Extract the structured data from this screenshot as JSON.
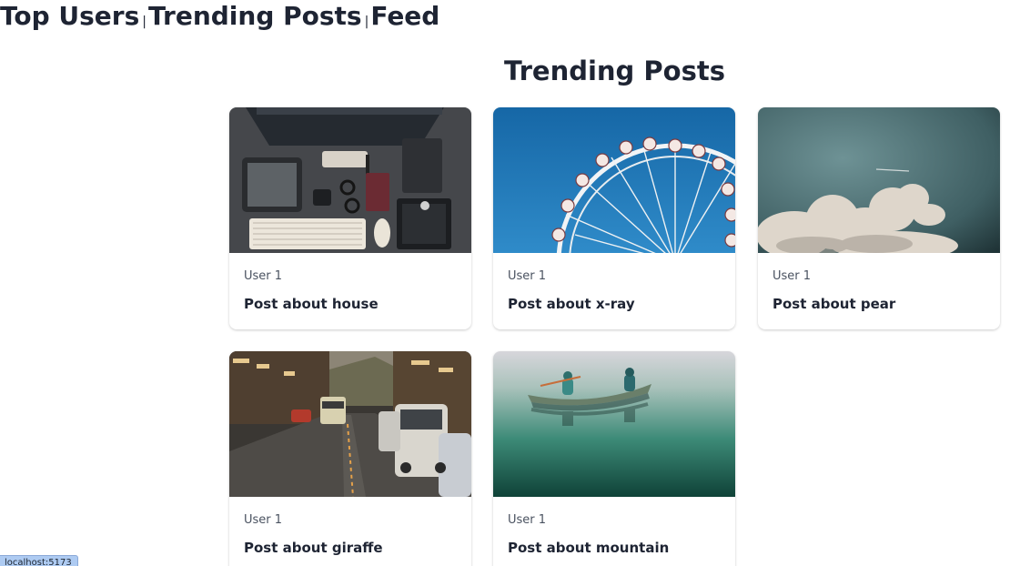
{
  "nav": {
    "links": [
      "Top Users",
      "Trending Posts",
      "Feed"
    ],
    "separator": "|"
  },
  "page": {
    "title": "Trending Posts"
  },
  "posts": [
    {
      "user": "User 1",
      "title": "Post about house",
      "image": "desk-workspace-photo"
    },
    {
      "user": "User 1",
      "title": "Post about x-ray",
      "image": "ferris-wheel-photo"
    },
    {
      "user": "User 1",
      "title": "Post about pear",
      "image": "clouds-sky-photo"
    },
    {
      "user": "User 1",
      "title": "Post about giraffe",
      "image": "city-street-photo"
    },
    {
      "user": "User 1",
      "title": "Post about mountain",
      "image": "canoe-lake-photo"
    }
  ],
  "status_bar": {
    "url": "localhost:5173"
  },
  "colors": {
    "text": "#1e2433",
    "muted_text": "#4a5260",
    "card_bg": "#ffffff",
    "status_bg": "#aecbf2"
  }
}
